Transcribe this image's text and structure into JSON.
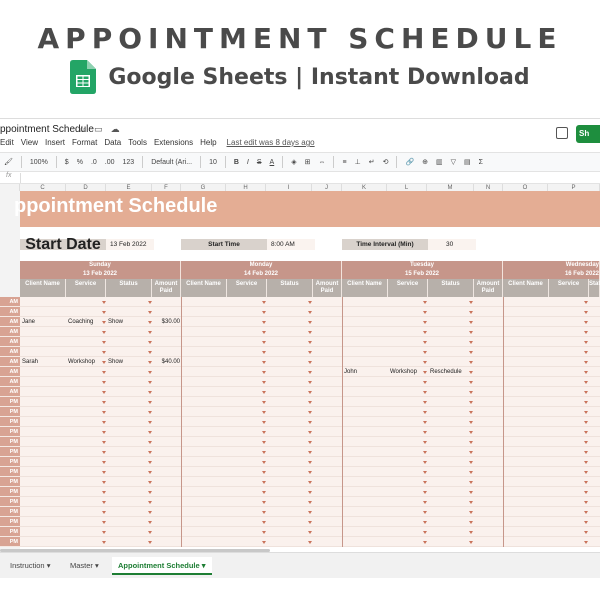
{
  "promo": {
    "title": "APPOINTMENT SCHEDULE",
    "subtitle": "Google Sheets | Instant Download"
  },
  "window": {
    "doc_title": "ppointment Schedule",
    "menus": [
      "Edit",
      "View",
      "Insert",
      "Format",
      "Data",
      "Tools",
      "Extensions",
      "Help"
    ],
    "last_edit": "Last edit was 8 days ago",
    "share_label": "Sh"
  },
  "toolbar": {
    "zoom": "100%",
    "currency": "$",
    "percent": "%",
    "dec1": ".0",
    "dec2": ".00",
    "more_formats": "123",
    "font": "Default (Ari...",
    "font_size": "10",
    "bold": "B",
    "italic": "I",
    "strike": "S",
    "text_color": "A"
  },
  "formula_bar": {
    "fx": "fx"
  },
  "columns": [
    "C",
    "D",
    "E",
    "F",
    "G",
    "H",
    "I",
    "J",
    "K",
    "L",
    "M",
    "N",
    "O",
    "P"
  ],
  "sheet": {
    "banner": "ppointment Schedule",
    "start_date_label": "Start Date",
    "start_date_value": "13 Feb 2022",
    "start_time_label": "Start Time",
    "start_time_value": "8:00 AM",
    "interval_label": "Time Interval (Min)",
    "interval_value": "30",
    "days": [
      {
        "name": "Sunday",
        "date": "13 Feb 2022"
      },
      {
        "name": "Monday",
        "date": "14 Feb 2022"
      },
      {
        "name": "Tuesday",
        "date": "15 Feb 2022"
      },
      {
        "name": "Wednesday",
        "date": "16 Feb 2022"
      }
    ],
    "subheaders": [
      "Client Name",
      "Service",
      "Status",
      "Amount Paid"
    ],
    "time_labels": [
      "AM",
      "AM",
      "AM",
      "AM",
      "AM",
      "AM",
      "AM",
      "AM",
      "AM",
      "AM",
      "PM",
      "PM",
      "PM",
      "PM",
      "PM",
      "PM",
      "PM",
      "PM",
      "PM",
      "PM",
      "PM",
      "PM",
      "PM",
      "PM",
      "PM"
    ],
    "entries": [
      {
        "row": 2,
        "day": 0,
        "client": "Jane",
        "service": "Coaching",
        "status": "Show",
        "amount": "$30.00"
      },
      {
        "row": 6,
        "day": 0,
        "client": "Sarah",
        "service": "Workshop",
        "status": "Show",
        "amount": "$40.00"
      },
      {
        "row": 7,
        "day": 2,
        "client": "John",
        "service": "Workshop",
        "status": "Reschedule",
        "amount": ""
      }
    ]
  },
  "tabs": [
    "Instruction",
    "Master",
    "Appointment Schedule"
  ],
  "active_tab": "Appointment Schedule",
  "colors": {
    "banner": "#e4ad94",
    "header": "#c6968a",
    "subheader": "#b7b0aa",
    "time_col": "#d8a393",
    "grid_bg": "#faf1ed",
    "accent_green": "#1e8e3e"
  }
}
